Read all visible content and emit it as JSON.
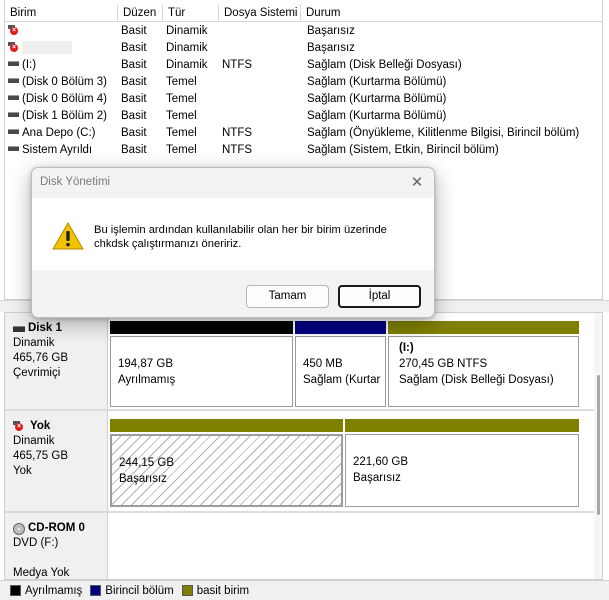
{
  "volume_list": {
    "columns": [
      "Birim",
      "Düzen",
      "Tür",
      "Dosya Sistemi",
      "Durum"
    ],
    "rows": [
      {
        "icon": "error-disk-icon",
        "name": "",
        "layout": "Basit",
        "type": "Dinamik",
        "fs": "",
        "status": "Başarısız"
      },
      {
        "icon": "error-disk-icon",
        "name": "",
        "layout": "Basit",
        "type": "Dinamik",
        "fs": "",
        "status": "Başarısız"
      },
      {
        "icon": "volume-icon",
        "name": "(I:)",
        "layout": "Basit",
        "type": "Dinamik",
        "fs": "NTFS",
        "status": "Sağlam (Disk Belleği Dosyası)"
      },
      {
        "icon": "volume-icon",
        "name": "(Disk 0 Bölüm 3)",
        "layout": "Basit",
        "type": "Temel",
        "fs": "",
        "status": "Sağlam (Kurtarma Bölümü)"
      },
      {
        "icon": "volume-icon",
        "name": "(Disk 0 Bölüm 4)",
        "layout": "Basit",
        "type": "Temel",
        "fs": "",
        "status": "Sağlam (Kurtarma Bölümü)"
      },
      {
        "icon": "volume-icon",
        "name": "(Disk 1 Bölüm 2)",
        "layout": "Basit",
        "type": "Temel",
        "fs": "",
        "status": "Sağlam (Kurtarma Bölümü)"
      },
      {
        "icon": "volume-icon",
        "name": "Ana Depo (C:)",
        "layout": "Basit",
        "type": "Temel",
        "fs": "NTFS",
        "status": "Sağlam (Önyükleme, Kilitlenme Bilgisi, Birincil bölüm)"
      },
      {
        "icon": "volume-icon",
        "name": "Sistem Ayrıldı",
        "layout": "Basit",
        "type": "Temel",
        "fs": "NTFS",
        "status": "Sağlam (Sistem, Etkin, Birincil bölüm)"
      }
    ]
  },
  "disks": [
    {
      "name": "Disk 1",
      "icon": "disk-icon",
      "kind": "Dinamik",
      "size": "465,76 GB",
      "state": "Çevrimiçi",
      "partitions": [
        {
          "bar_color": "#000000",
          "line1": "",
          "line2": "194,87 GB",
          "line3": "Ayrılmamış"
        },
        {
          "bar_color": "#000080",
          "line1": "",
          "line2": "450 MB",
          "line3": "Sağlam (Kurtar"
        },
        {
          "bar_color": "#808000",
          "line1": "(I:)",
          "line2": "270,45 GB NTFS",
          "line3": "Sağlam (Disk Belleği Dosyası)"
        }
      ]
    },
    {
      "name": "Yok",
      "icon": "error-disk-icon",
      "kind": "Dinamik",
      "size": "465,75 GB",
      "state": "Yok",
      "partitions": [
        {
          "bar_color": "#808000",
          "line1": "",
          "line2": "244,15 GB",
          "line3": "Başarısız"
        },
        {
          "bar_color": "#808000",
          "line1": "",
          "line2": "221,60 GB",
          "line3": "Başarısız"
        }
      ]
    },
    {
      "name": "CD-ROM 0",
      "icon": "cdrom-icon",
      "kind": "DVD (F:)",
      "size": "",
      "state": "Medya Yok"
    }
  ],
  "legend": [
    {
      "label": "Ayrılmamış",
      "color": "#000000"
    },
    {
      "label": "Birincil bölüm",
      "color": "#000080"
    },
    {
      "label": "basit birim",
      "color": "#808000"
    }
  ],
  "dialog": {
    "title": "Disk Yönetimi",
    "close_icon": "close-icon",
    "warning_icon": "warning-icon",
    "message_line1": "Bu işlemin ardından kullanılabilir olan her bir birim üzerinde",
    "message_line2": "chkdsk çalıştırmanızı öneririz.",
    "ok_label": "Tamam",
    "cancel_label": "İptal"
  }
}
